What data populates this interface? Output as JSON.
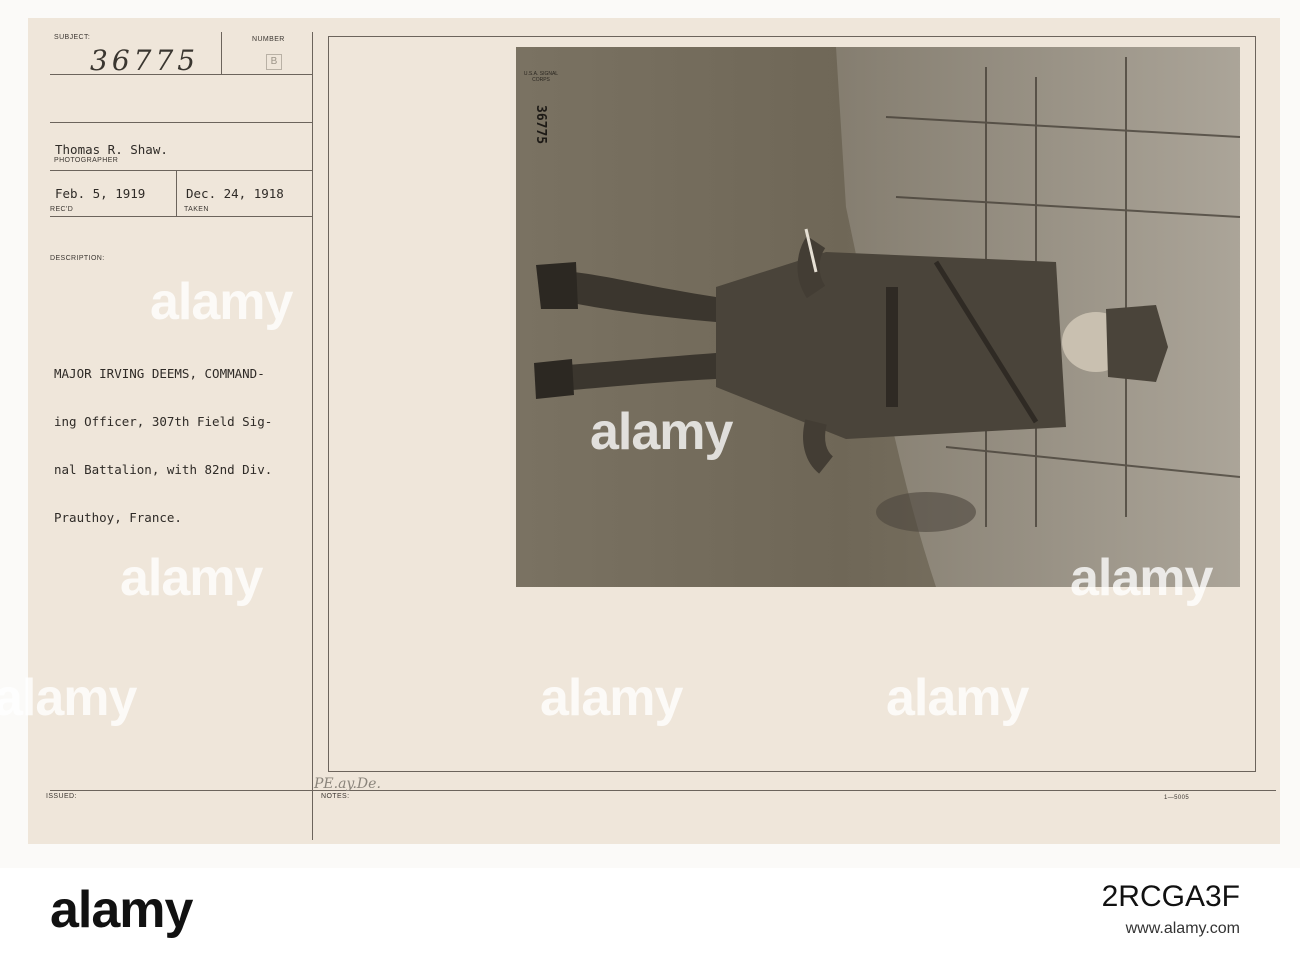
{
  "record": {
    "subject_label": "SUBJECT:",
    "subject_value": "36775",
    "number_label": "NUMBER",
    "number_value": "B",
    "photographer_name": "Thomas R. Shaw.",
    "photographer_label": "PHOTOGRAPHER",
    "received_date": "Feb. 5, 1919",
    "received_label": "REC'D",
    "taken_date": "Dec. 24, 1918",
    "taken_label": "TAKEN",
    "description_label": "DESCRIPTION:",
    "description_lines": [
      "MAJOR IRVING DEEMS, COMMAND-",
      "ing Officer, 307th Field Sig-",
      "nal Battalion, with 82nd Div.",
      "Prauthoy, France."
    ],
    "issued_label": "ISSUED:",
    "notes_label": "NOTES:",
    "notes_handwriting": "PE.ay.De.",
    "form_code": "1—5005"
  },
  "photo": {
    "negative_number": "36775",
    "stamp_text": "U.S.A. SIGNAL CORPS"
  },
  "watermark": {
    "text": "alamy",
    "image_id": "2RCGA3F",
    "domain": "www.alamy.com"
  }
}
